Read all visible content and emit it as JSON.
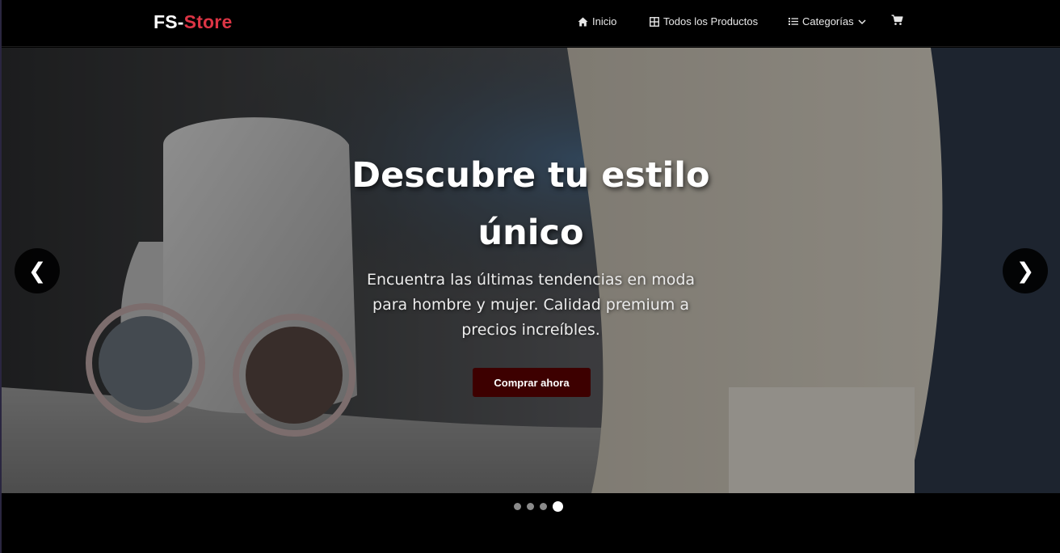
{
  "brand": {
    "prefix": "FS-",
    "accent": "Store",
    "accent_color": "#dc3545"
  },
  "nav": {
    "inicio": {
      "label": "Inicio",
      "icon": "home-icon"
    },
    "productos": {
      "label": "Todos los Productos",
      "icon": "grid-icon"
    },
    "categorias": {
      "label": "Categorías",
      "icon": "list-icon",
      "caret": "chevron-down-icon"
    },
    "cart": {
      "icon": "cart-icon"
    }
  },
  "hero": {
    "title_line1": "Descubre tu estilo",
    "title_line2": "único",
    "subtitle": "Encuentra las últimas tendencias en moda para hombre y mujer. Calidad premium a precios increíbles.",
    "button_label": "Comprar ahora",
    "button_color": "#3d0000",
    "prev_arrow": "❮",
    "next_arrow": "❯"
  },
  "carousel": {
    "slides": 4,
    "active_index": 3
  }
}
